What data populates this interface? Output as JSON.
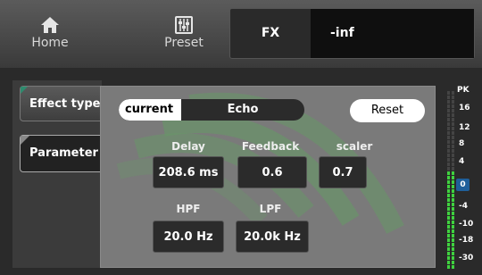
{
  "nav": {
    "home_label": "Home",
    "preset_label": "Preset"
  },
  "fx": {
    "label": "FX",
    "value": "-inf"
  },
  "tabs": {
    "effect_type": "Effect type",
    "parameter": "Parameter"
  },
  "selector": {
    "current_label": "current",
    "effect_name": "Echo"
  },
  "reset_label": "Reset",
  "params": {
    "delay": {
      "label": "Delay",
      "value": "208.6 ms"
    },
    "feedback": {
      "label": "Feedback",
      "value": "0.6"
    },
    "scaler": {
      "label": "scaler",
      "value": "0.7"
    },
    "hpf": {
      "label": "HPF",
      "value": "20.0 Hz"
    },
    "lpf": {
      "label": "LPF",
      "value": "20.0k Hz"
    }
  },
  "meter": {
    "peak_label": "PK",
    "ticks": [
      "16",
      "12",
      "8",
      "4",
      "0",
      "-4",
      "-10",
      "-18",
      "-30"
    ],
    "colors": {
      "green": "#3fd13f",
      "badge": "#1f5f9a"
    }
  }
}
